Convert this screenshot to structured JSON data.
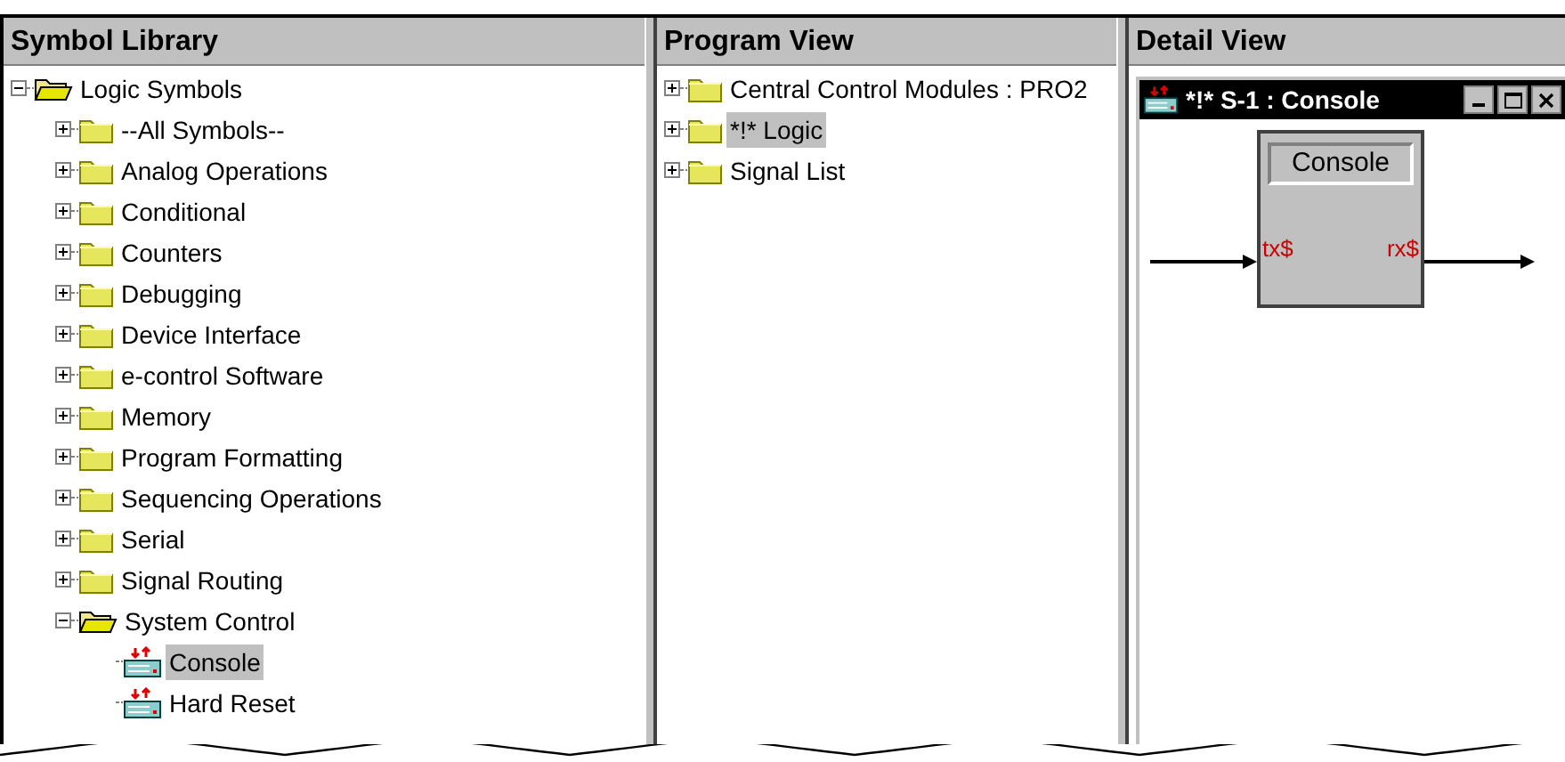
{
  "symbol_library": {
    "title": "Symbol Library",
    "tree": [
      {
        "label": "Logic Symbols",
        "kind": "folder",
        "expanded": true,
        "selected": false,
        "children": [
          {
            "label": "--All Symbols--",
            "kind": "folder",
            "expanded": false,
            "selected": false
          },
          {
            "label": "Analog Operations",
            "kind": "folder",
            "expanded": false,
            "selected": false
          },
          {
            "label": "Conditional",
            "kind": "folder",
            "expanded": false,
            "selected": false
          },
          {
            "label": "Counters",
            "kind": "folder",
            "expanded": false,
            "selected": false
          },
          {
            "label": "Debugging",
            "kind": "folder",
            "expanded": false,
            "selected": false
          },
          {
            "label": "Device Interface",
            "kind": "folder",
            "expanded": false,
            "selected": false
          },
          {
            "label": "e-control Software",
            "kind": "folder",
            "expanded": false,
            "selected": false
          },
          {
            "label": "Memory",
            "kind": "folder",
            "expanded": false,
            "selected": false
          },
          {
            "label": "Program Formatting",
            "kind": "folder",
            "expanded": false,
            "selected": false
          },
          {
            "label": "Sequencing Operations",
            "kind": "folder",
            "expanded": false,
            "selected": false
          },
          {
            "label": "Serial",
            "kind": "folder",
            "expanded": false,
            "selected": false
          },
          {
            "label": "Signal Routing",
            "kind": "folder",
            "expanded": false,
            "selected": false
          },
          {
            "label": "System Control",
            "kind": "folder",
            "expanded": true,
            "selected": false,
            "children": [
              {
                "label": "Console",
                "kind": "symbol",
                "selected": true
              },
              {
                "label": "Hard Reset",
                "kind": "symbol",
                "selected": false
              }
            ]
          }
        ]
      }
    ]
  },
  "program_view": {
    "title": "Program View",
    "tree": [
      {
        "label": "Central Control Modules : PRO2",
        "kind": "folder",
        "expanded": false,
        "selected": false
      },
      {
        "label": "*!* Logic",
        "kind": "folder",
        "expanded": false,
        "selected": true
      },
      {
        "label": "Signal List",
        "kind": "folder",
        "expanded": false,
        "selected": false
      }
    ]
  },
  "detail_view": {
    "title": "Detail View",
    "window": {
      "title": "*!* S-1 : Console"
    },
    "block": {
      "name": "Console",
      "input": "tx$",
      "output": "rx$"
    }
  }
}
